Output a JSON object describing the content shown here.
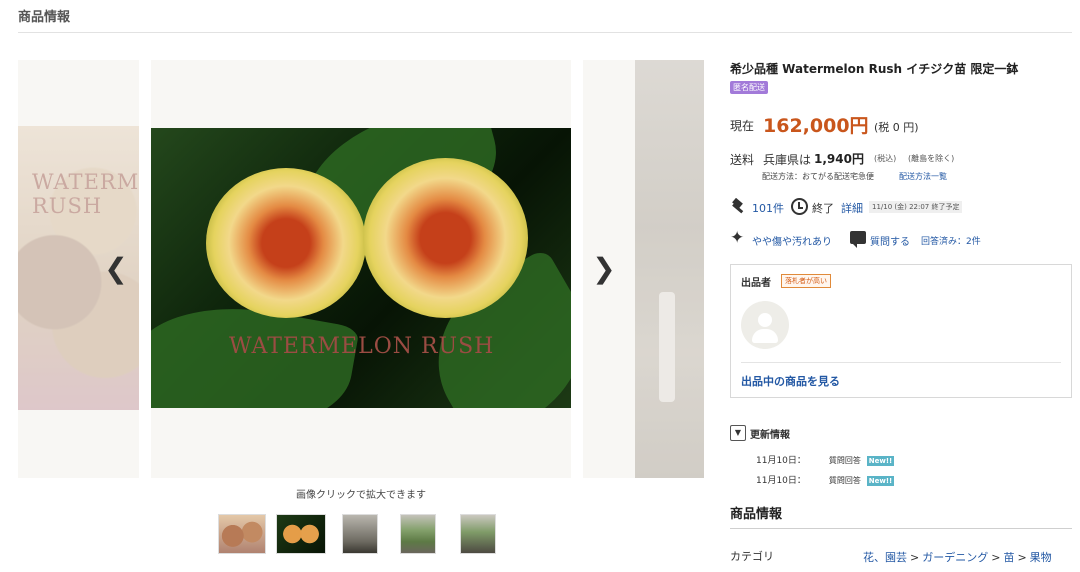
{
  "section_heading": "商品情報",
  "gallery": {
    "watermark": "WATERMELON RUSH",
    "caption": "画像クリックで拡大できます",
    "nav_prev_icon": "chevron-left-icon",
    "nav_next_icon": "chevron-right-icon",
    "thumbnail_count": 5
  },
  "product": {
    "title": "希少品種 Watermelon Rush イチジク苗 限定一鉢",
    "anonymous_badge": "匿名配送",
    "price_label": "現在",
    "price": "162,000円",
    "tax_note": "(税 0 円)",
    "shipping": {
      "label": "送料",
      "prefecture": "兵庫県は",
      "price": "1,940円",
      "tax_in": "(税込)",
      "exclusion": "(離島を除く)",
      "method": "配送方法：おてがる配送宅急便",
      "method_link": "配送方法一覧"
    },
    "bids": "101件",
    "end_label": "終了",
    "detail_link": "詳細",
    "end_date": "11/10 (金) 22:07 終了予定",
    "condition": "やや傷や汚れあり",
    "ask_link": "質問する",
    "answered": "回答済み：2件"
  },
  "seller": {
    "label": "出品者",
    "badge": "落札者が高い",
    "items_link": "出品中の商品を見る"
  },
  "updates": {
    "title": "更新情報",
    "toggle_icon": "caret-down-icon",
    "rows": [
      {
        "date": "11月10日：",
        "type": "質問回答",
        "badge": "New!!"
      },
      {
        "date": "11月10日：",
        "type": "質問回答",
        "badge": "New!!"
      }
    ]
  },
  "info": {
    "title": "商品情報",
    "category_label": "カテゴリ",
    "category_path": [
      "花、園芸",
      "ガーデニング",
      "苗",
      "果物"
    ],
    "separator": ">"
  },
  "colors": {
    "price": "#c9561c",
    "link": "#2358a4",
    "anon_badge": "#a27ad9",
    "new_badge": "#5ab4c7"
  }
}
